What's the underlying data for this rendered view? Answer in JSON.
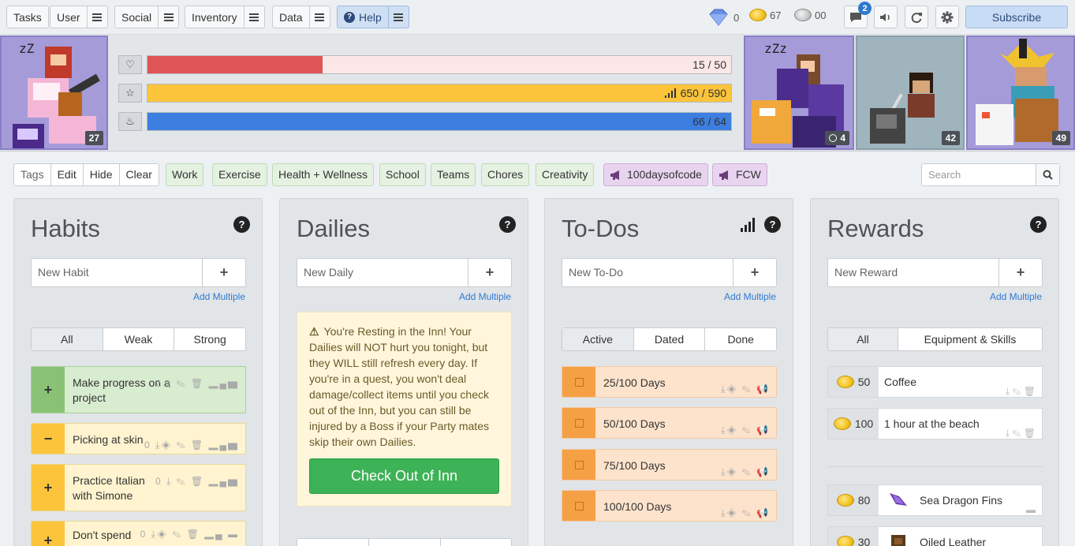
{
  "nav": {
    "tasks": "Tasks",
    "user": "User",
    "social": "Social",
    "inventory": "Inventory",
    "data": "Data",
    "help": "Help",
    "gems": "0",
    "gold": "67",
    "silver": "00",
    "notif_count": "2",
    "subscribe": "Subscribe"
  },
  "stats": {
    "health": {
      "text": "15 / 50",
      "fraction": 0.3,
      "color": "#df5556"
    },
    "experience": {
      "text": "650 / 590",
      "fraction": 1.0,
      "color": "#fbc43b"
    },
    "mana": {
      "text": "66 / 64",
      "fraction": 1.0,
      "color": "#3d7fe0"
    }
  },
  "party": {
    "my_level": "27",
    "m1_level": "4",
    "m2_level": "42",
    "m3_level": "49"
  },
  "filters": {
    "tags": "Tags",
    "edit": "Edit",
    "hide": "Hide",
    "clear": "Clear",
    "items": [
      "Work",
      "Exercise",
      "Health + Wellness",
      "School",
      "Teams",
      "Chores",
      "Creativity",
      "100daysofcode",
      "FCW"
    ],
    "search_placeholder": "Search"
  },
  "habits": {
    "title": "Habits",
    "new": "New Habit",
    "add_multiple": "Add Multiple",
    "tabs": [
      "All",
      "Weak",
      "Strong"
    ],
    "items": [
      {
        "label": "Make progress on a project",
        "count": "2",
        "ctl": "+"
      },
      {
        "label": "Picking at skin",
        "count": "0",
        "ctl": "−"
      },
      {
        "label": "Practice Italian with Simone",
        "count": "0",
        "ctl": "+"
      },
      {
        "label": "Don't spend",
        "count": "0",
        "ctl": "+"
      }
    ]
  },
  "dailies": {
    "title": "Dailies",
    "new": "New Daily",
    "add_multiple": "Add Multiple",
    "inn_text": "You're Resting in the Inn! Your Dailies will NOT hurt you tonight, but they WILL still refresh every day. If you're in a quest, you won't deal damage/collect items until you check out of the Inn, but you can still be injured by a Boss if your Party mates skip their own Dailies.",
    "inn_button": "Check Out of Inn"
  },
  "todos": {
    "title": "To-Dos",
    "new": "New To-Do",
    "add_multiple": "Add Multiple",
    "tabs": [
      "Active",
      "Dated",
      "Done"
    ],
    "items": [
      "25/100 Days",
      "50/100 Days",
      "75/100 Days",
      "100/100 Days"
    ]
  },
  "rewards": {
    "title": "Rewards",
    "new": "New Reward",
    "add_multiple": "Add Multiple",
    "tabs": [
      "All",
      "Equipment & Skills"
    ],
    "custom": [
      {
        "price": "50",
        "label": "Coffee"
      },
      {
        "price": "100",
        "label": "1 hour at the beach"
      }
    ],
    "gear": [
      {
        "price": "80",
        "label": "Sea Dragon Fins"
      },
      {
        "price": "30",
        "label": "Oiled Leather"
      }
    ]
  }
}
